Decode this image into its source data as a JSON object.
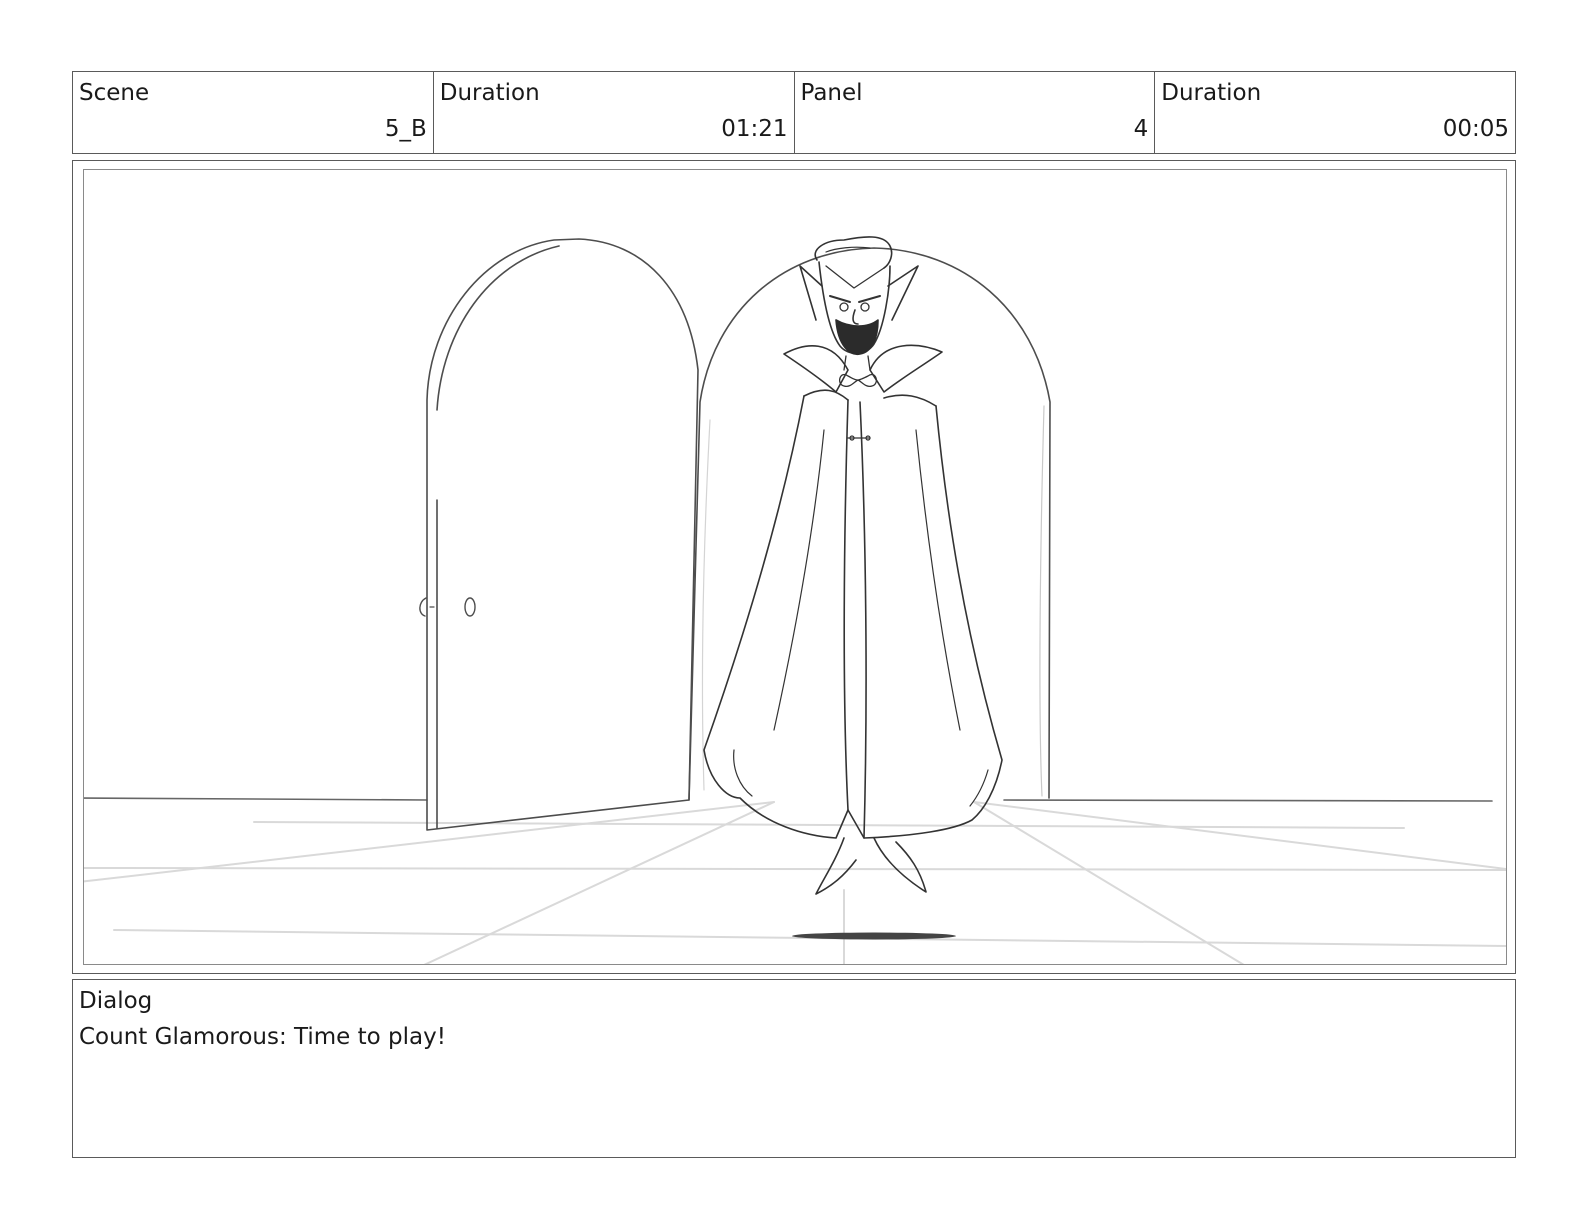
{
  "header": {
    "scene_label": "Scene",
    "scene_value": "5_B",
    "scene_duration_label": "Duration",
    "scene_duration_value": "01:21",
    "panel_label": "Panel",
    "panel_value": "4",
    "panel_duration_label": "Duration",
    "panel_duration_value": "00:05"
  },
  "dialog": {
    "label": "Dialog",
    "text": "Count Glamorous: Time to play!"
  }
}
